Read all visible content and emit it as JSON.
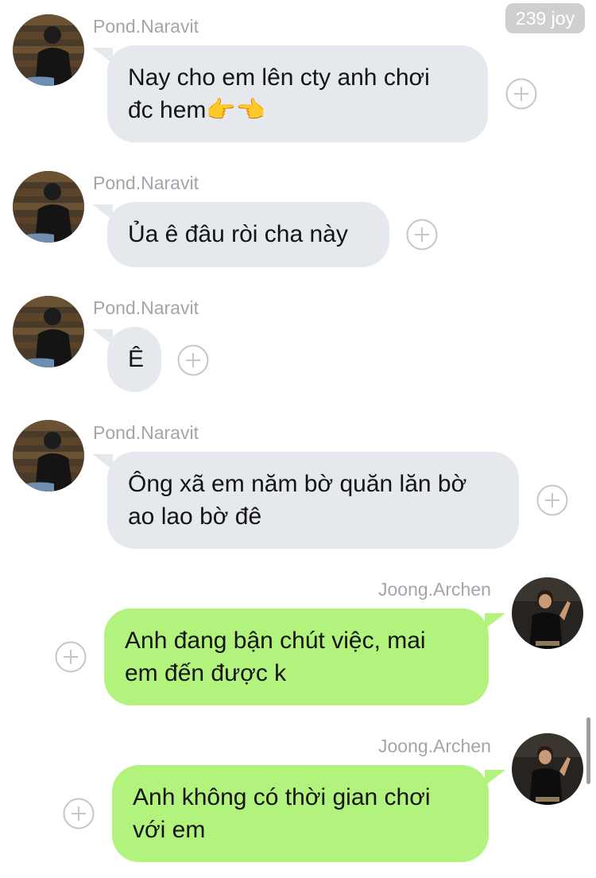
{
  "header": {
    "badge": "239 joy"
  },
  "messages": [
    {
      "sender": "Pond.Naravit",
      "direction": "incoming",
      "lines": [
        "Nay cho em lên cty anh chơi",
        "đc hem👉👈"
      ]
    },
    {
      "sender": "Pond.Naravit",
      "direction": "incoming",
      "lines": [
        "Ủa ê đâu ròi cha này"
      ]
    },
    {
      "sender": "Pond.Naravit",
      "direction": "incoming",
      "lines": [
        "Ê"
      ]
    },
    {
      "sender": "Pond.Naravit",
      "direction": "incoming",
      "lines": [
        "Ông xã em năm bờ quăn lăn bờ",
        "ao lao bờ đê"
      ]
    },
    {
      "sender": "Joong.Archen",
      "direction": "outgoing",
      "lines": [
        "Anh đang bận chút việc, mai",
        "em đến được k"
      ]
    },
    {
      "sender": "Joong.Archen",
      "direction": "outgoing",
      "lines": [
        "Anh không có thời gian chơi",
        "với em"
      ]
    }
  ],
  "colors": {
    "incoming_bubble": "#e5e8ec",
    "outgoing_bubble": "#b2f37e",
    "sender_text": "#a2a5ab",
    "badge_bg": "#cfcfd2"
  },
  "icons": {
    "react": "plus-circle-icon"
  }
}
